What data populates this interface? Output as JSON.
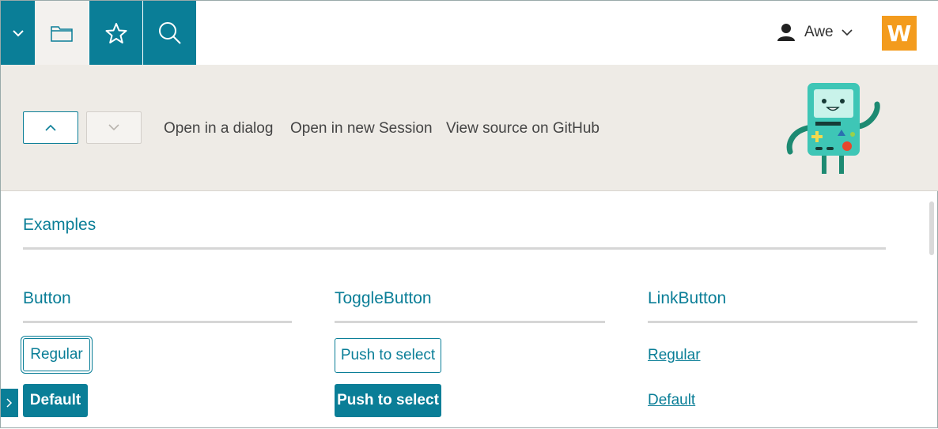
{
  "header": {
    "nav": [
      {
        "icon": "chevron-down-icon"
      },
      {
        "icon": "folder-icon",
        "active": true
      },
      {
        "icon": "star-icon"
      },
      {
        "icon": "search-icon"
      }
    ],
    "user": {
      "name": "Awe",
      "icon": "user-icon"
    },
    "logo_letter": "W"
  },
  "toolbar": {
    "links": [
      "Open in a dialog",
      "Open in new Session",
      "View source on GitHub"
    ]
  },
  "main": {
    "section_title": "Examples",
    "columns": [
      {
        "title": "Button",
        "items": [
          "Regular",
          "Default"
        ]
      },
      {
        "title": "ToggleButton",
        "items": [
          "Push to select",
          "Push to select"
        ]
      },
      {
        "title": "LinkButton",
        "items": [
          "Regular",
          "Default"
        ]
      }
    ]
  },
  "colors": {
    "accent": "#0a7e97",
    "logo": "#f39b1d",
    "band": "#eeebe6"
  }
}
